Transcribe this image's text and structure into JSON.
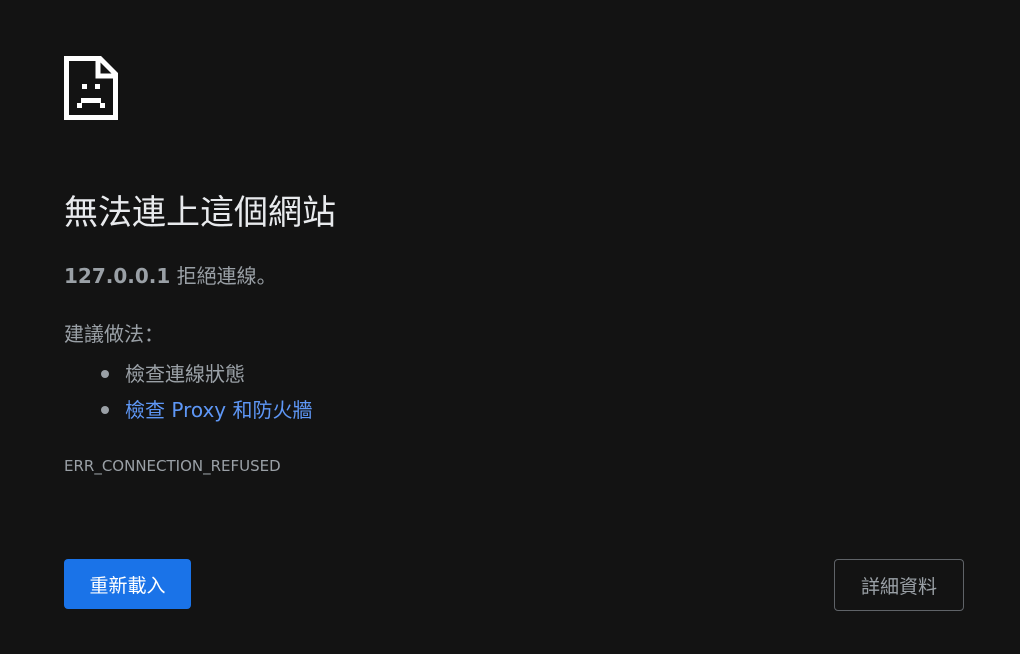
{
  "icon": "sad-document-icon",
  "colors": {
    "background": "#131313",
    "title": "#e8eaed",
    "text": "#9aa0a6",
    "link": "#5e97f6",
    "primary_button": "#1a73e8",
    "secondary_border": "#5f6368"
  },
  "error": {
    "title": "無法連上這個網站",
    "host": "127.0.0.1",
    "summary_suffix": " 拒絕連線。",
    "suggestions_heading": "建議做法：",
    "suggestions": [
      {
        "label": "檢查連線狀態",
        "is_link": false
      },
      {
        "label": "檢查 Proxy 和防火牆",
        "is_link": true
      }
    ],
    "code": "ERR_CONNECTION_REFUSED"
  },
  "buttons": {
    "reload_label": "重新載入",
    "details_label": "詳細資料"
  }
}
